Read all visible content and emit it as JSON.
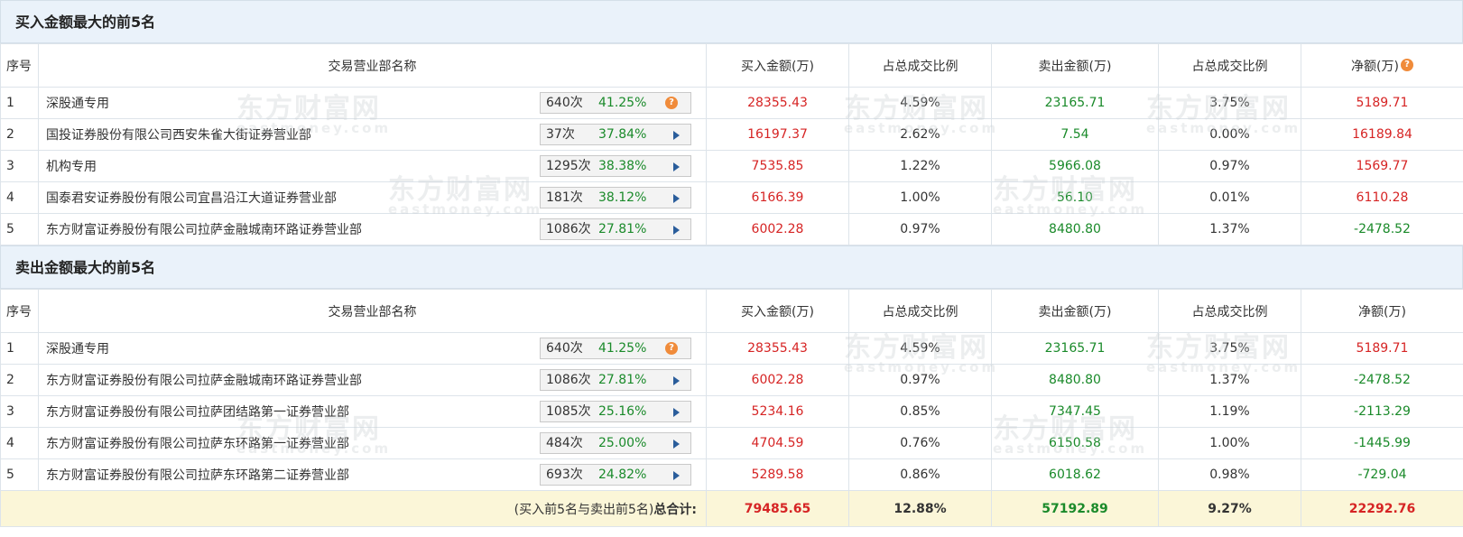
{
  "buy_section": {
    "title": "买入金额最大的前5名",
    "headers": [
      "序号",
      "交易营业部名称",
      "买入金额(万)",
      "占总成交比例",
      "卖出金额(万)",
      "占总成交比例",
      "净额(万)"
    ],
    "rows": [
      {
        "idx": "1",
        "name": "深股通专用",
        "count": "640次",
        "pct": "41.25%",
        "icon": "question-icon",
        "buy": "28355.43",
        "buy_ratio": "4.59%",
        "sell": "23165.71",
        "sell_ratio": "3.75%",
        "net": "5189.71"
      },
      {
        "idx": "2",
        "name": "国投证券股份有限公司西安朱雀大街证券营业部",
        "count": "37次",
        "pct": "37.84%",
        "icon": "play-icon",
        "buy": "16197.37",
        "buy_ratio": "2.62%",
        "sell": "7.54",
        "sell_ratio": "0.00%",
        "net": "16189.84"
      },
      {
        "idx": "3",
        "name": "机构专用",
        "count": "1295次",
        "pct": "38.38%",
        "icon": "play-icon",
        "buy": "7535.85",
        "buy_ratio": "1.22%",
        "sell": "5966.08",
        "sell_ratio": "0.97%",
        "net": "1569.77"
      },
      {
        "idx": "4",
        "name": "国泰君安证券股份有限公司宜昌沿江大道证券营业部",
        "count": "181次",
        "pct": "38.12%",
        "icon": "play-icon",
        "buy": "6166.39",
        "buy_ratio": "1.00%",
        "sell": "56.10",
        "sell_ratio": "0.01%",
        "net": "6110.28"
      },
      {
        "idx": "5",
        "name": "东方财富证券股份有限公司拉萨金融城南环路证券营业部",
        "count": "1086次",
        "pct": "27.81%",
        "icon": "play-icon",
        "buy": "6002.28",
        "buy_ratio": "0.97%",
        "sell": "8480.80",
        "sell_ratio": "1.37%",
        "net": "-2478.52"
      }
    ]
  },
  "sell_section": {
    "title": "卖出金额最大的前5名",
    "headers": [
      "序号",
      "交易营业部名称",
      "买入金额(万)",
      "占总成交比例",
      "卖出金额(万)",
      "占总成交比例",
      "净额(万)"
    ],
    "rows": [
      {
        "idx": "1",
        "name": "深股通专用",
        "count": "640次",
        "pct": "41.25%",
        "icon": "question-icon",
        "buy": "28355.43",
        "buy_ratio": "4.59%",
        "sell": "23165.71",
        "sell_ratio": "3.75%",
        "net": "5189.71"
      },
      {
        "idx": "2",
        "name": "东方财富证券股份有限公司拉萨金融城南环路证券营业部",
        "count": "1086次",
        "pct": "27.81%",
        "icon": "play-icon",
        "buy": "6002.28",
        "buy_ratio": "0.97%",
        "sell": "8480.80",
        "sell_ratio": "1.37%",
        "net": "-2478.52"
      },
      {
        "idx": "3",
        "name": "东方财富证券股份有限公司拉萨团结路第一证券营业部",
        "count": "1085次",
        "pct": "25.16%",
        "icon": "play-icon",
        "buy": "5234.16",
        "buy_ratio": "0.85%",
        "sell": "7347.45",
        "sell_ratio": "1.19%",
        "net": "-2113.29"
      },
      {
        "idx": "4",
        "name": "东方财富证券股份有限公司拉萨东环路第一证券营业部",
        "count": "484次",
        "pct": "25.00%",
        "icon": "play-icon",
        "buy": "4704.59",
        "buy_ratio": "0.76%",
        "sell": "6150.58",
        "sell_ratio": "1.00%",
        "net": "-1445.99"
      },
      {
        "idx": "5",
        "name": "东方财富证券股份有限公司拉萨东环路第二证券营业部",
        "count": "693次",
        "pct": "24.82%",
        "icon": "play-icon",
        "buy": "5289.58",
        "buy_ratio": "0.86%",
        "sell": "6018.62",
        "sell_ratio": "0.98%",
        "net": "-729.04"
      }
    ]
  },
  "total": {
    "label_prefix": "(买入前5名与卖出前5名)",
    "label_main": "总合计:",
    "buy": "79485.65",
    "buy_ratio": "12.88%",
    "sell": "57192.89",
    "sell_ratio": "9.27%",
    "net": "22292.76"
  },
  "watermark": {
    "brand": "东方财富网",
    "domain": "eastmoney.com"
  },
  "colors": {
    "red": "#d62424",
    "green": "#1a8a2a",
    "header_bg": "#eaf2fa",
    "total_bg": "#fbf6d8",
    "icon_orange": "#f08b3a",
    "play_blue": "#2a5d9b"
  }
}
